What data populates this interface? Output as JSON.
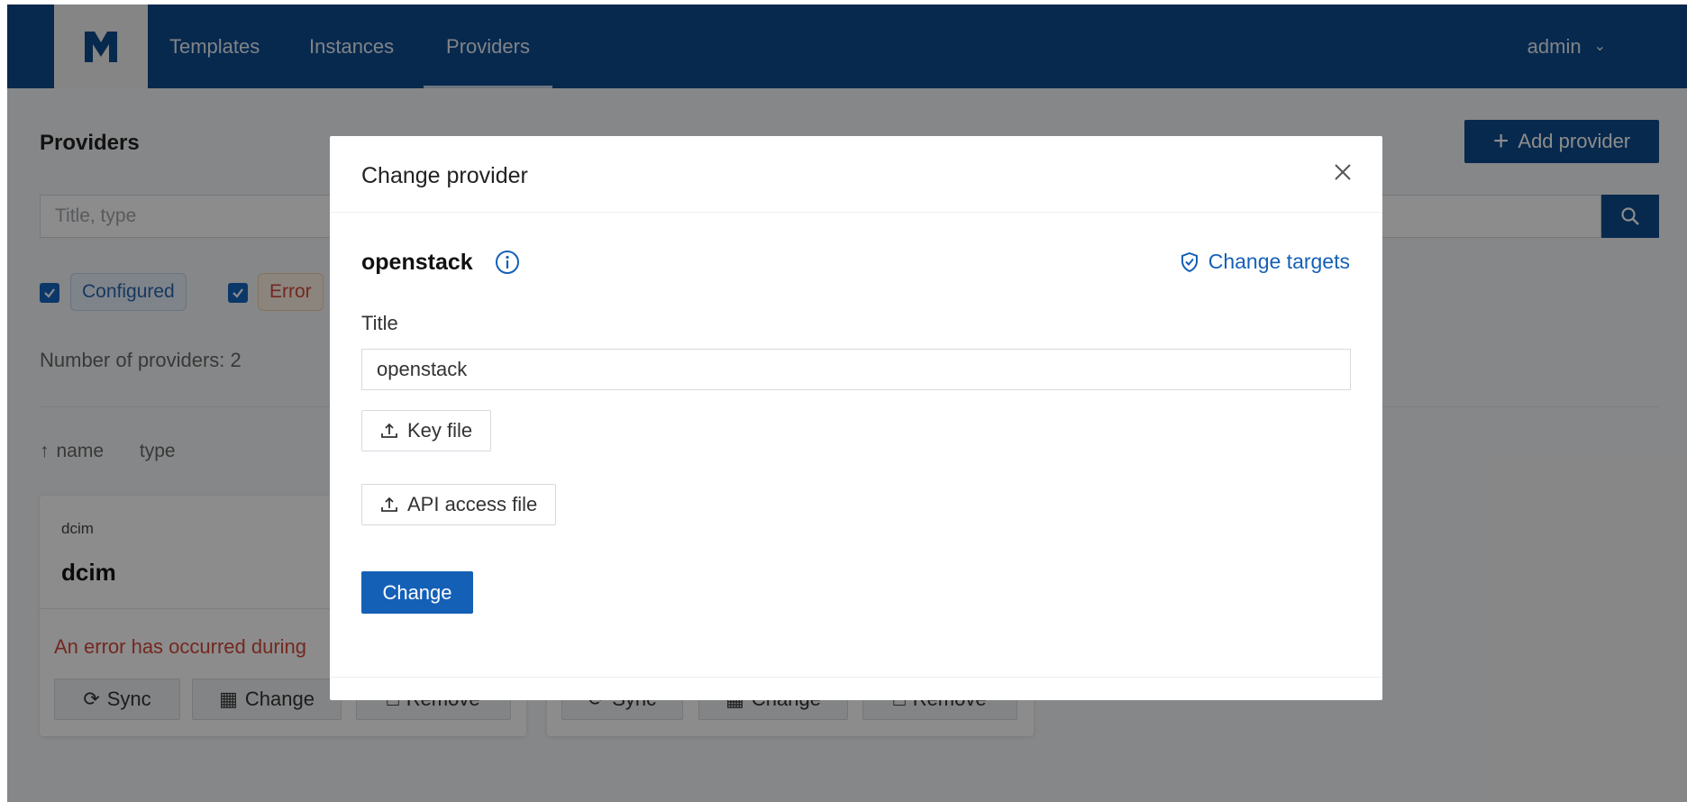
{
  "nav": {
    "items": [
      {
        "label": "Templates"
      },
      {
        "label": "Instances"
      },
      {
        "label": "Providers"
      }
    ],
    "active": "Providers",
    "user": "admin"
  },
  "page": {
    "title": "Providers",
    "add_button": "Add provider",
    "search_placeholder": "Title, type",
    "filters": [
      {
        "label": "Configured",
        "checked": true
      },
      {
        "label": "Error",
        "checked": true
      }
    ],
    "count_text": "Number of providers: 2",
    "sort": {
      "name": "name",
      "type": "type"
    }
  },
  "cards": [
    {
      "type": "dcim",
      "name": "dcim",
      "error": "An error has occurred during",
      "buttons": {
        "sync": "Sync",
        "change": "Change",
        "remove": "Remove"
      }
    },
    {
      "buttons": {
        "sync": "Sync",
        "change": "Change",
        "remove": "Remove"
      }
    }
  ],
  "modal": {
    "title": "Change provider",
    "provider_name": "openstack",
    "change_targets": "Change targets",
    "title_label": "Title",
    "title_value": "openstack",
    "key_file": "Key file",
    "api_access_file": "API access file",
    "submit": "Change"
  },
  "colors": {
    "brand": "#0d4b8f",
    "primary": "#1560b7",
    "error": "#d24a3c"
  }
}
